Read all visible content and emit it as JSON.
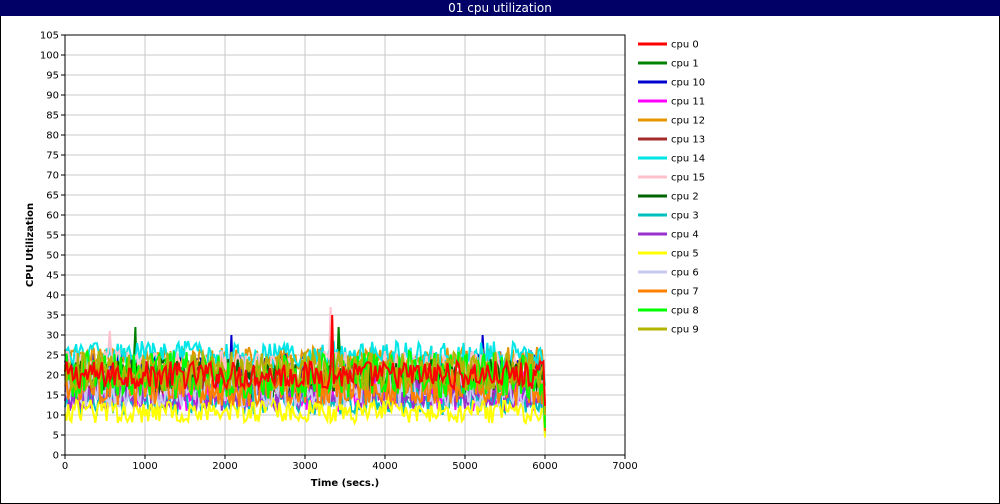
{
  "window": {
    "title": "01 cpu utilization"
  },
  "chart_data": {
    "type": "line",
    "title": "01 cpu utilization",
    "xlabel": "Time (secs.)",
    "ylabel": "CPU Utilization",
    "xlim": [
      0,
      7000
    ],
    "ylim": [
      0,
      105
    ],
    "xticks": [
      0,
      1000,
      2000,
      3000,
      4000,
      5000,
      6000,
      7000
    ],
    "yticks": [
      0,
      5,
      10,
      15,
      20,
      25,
      30,
      35,
      40,
      45,
      50,
      55,
      60,
      65,
      70,
      75,
      80,
      85,
      90,
      95,
      100,
      105
    ],
    "grid": true,
    "legend_position": "right",
    "x_start": 0,
    "x_end": 6000,
    "x_step": 20,
    "series": [
      {
        "name": "cpu 0",
        "color": "#ff0000",
        "mean": 20,
        "spread": 3.5,
        "peaks": [
          [
            3340,
            35
          ]
        ]
      },
      {
        "name": "cpu 1",
        "color": "#008000",
        "mean": 19,
        "spread": 5.5,
        "peaks": [
          [
            880,
            32
          ],
          [
            3420,
            32
          ]
        ]
      },
      {
        "name": "cpu 10",
        "color": "#0000cc",
        "mean": 21,
        "spread": 5.0,
        "peaks": [
          [
            2080,
            30
          ],
          [
            5220,
            30
          ]
        ]
      },
      {
        "name": "cpu 11",
        "color": "#ff00ff",
        "mean": 16,
        "spread": 5.0,
        "peaks": [
          [
            5170,
            36.5
          ]
        ]
      },
      {
        "name": "cpu 12",
        "color": "#e69500",
        "mean": 24,
        "spread": 3.0,
        "peaks": []
      },
      {
        "name": "cpu 13",
        "color": "#a52a2a",
        "mean": 19,
        "spread": 3.5,
        "peaks": []
      },
      {
        "name": "cpu 14",
        "color": "#00e5e5",
        "mean": 25,
        "spread": 3.5,
        "peaks": []
      },
      {
        "name": "cpu 15",
        "color": "#ffc0cb",
        "mean": 22,
        "spread": 4.0,
        "peaks": [
          [
            3320,
            37
          ],
          [
            560,
            31
          ]
        ]
      },
      {
        "name": "cpu 2",
        "color": "#006400",
        "mean": 19,
        "spread": 5.0,
        "peaks": []
      },
      {
        "name": "cpu 3",
        "color": "#00bfbf",
        "mean": 14,
        "spread": 4.0,
        "peaks": []
      },
      {
        "name": "cpu 4",
        "color": "#9932cc",
        "mean": 15,
        "spread": 4.0,
        "peaks": []
      },
      {
        "name": "cpu 5",
        "color": "#ffff00",
        "mean": 11,
        "spread": 3.0,
        "peaks": []
      },
      {
        "name": "cpu 6",
        "color": "#c8c8f0",
        "mean": 16,
        "spread": 4.0,
        "peaks": []
      },
      {
        "name": "cpu 7",
        "color": "#ff8000",
        "mean": 17,
        "spread": 5.0,
        "peaks": []
      },
      {
        "name": "cpu 8",
        "color": "#00ff00",
        "mean": 20,
        "spread": 6.0,
        "peaks": [
          [
            1550,
            34
          ],
          [
            2090,
            33.5
          ]
        ]
      },
      {
        "name": "cpu 9",
        "color": "#b3b300",
        "mean": 21,
        "spread": 5.0,
        "peaks": [
          [
            1990,
            33
          ]
        ]
      }
    ]
  }
}
